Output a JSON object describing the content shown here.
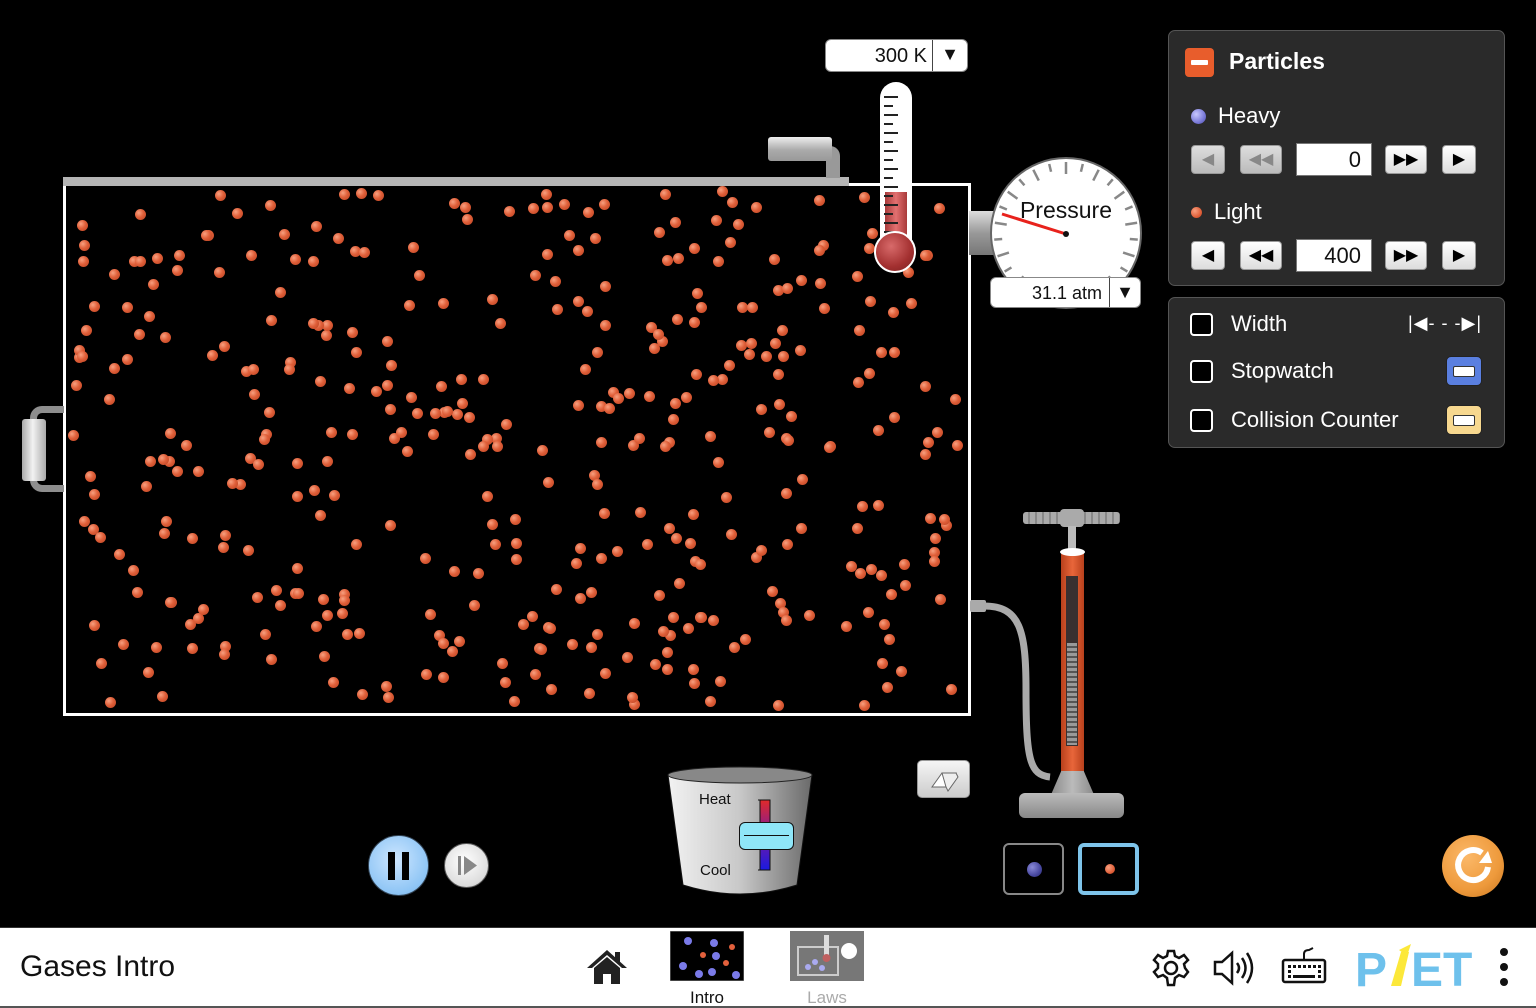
{
  "app": {
    "title": "Gases Intro",
    "screens": [
      {
        "label": "Intro",
        "selected": true
      },
      {
        "label": "Laws",
        "selected": false
      }
    ]
  },
  "thermometer": {
    "value": "300 K",
    "dropdown_icon": "triangle-down"
  },
  "pressure_gauge": {
    "label": "Pressure",
    "value": "31.1 atm",
    "dropdown_icon": "triangle-down"
  },
  "particles_panel": {
    "title": "Particles",
    "collapse_icon": "minus",
    "heavy": {
      "label": "Heavy",
      "count": "0",
      "color": "#8080f0"
    },
    "light": {
      "label": "Light",
      "count": "400",
      "color": "#e2603c"
    }
  },
  "tools_panel": {
    "items": [
      {
        "label": "Width",
        "checked": false,
        "icon": "width-arrows",
        "icon_text": "|◀- - -▶|"
      },
      {
        "label": "Stopwatch",
        "checked": false,
        "icon": "stopwatch",
        "icon_color": "#5a7fe0"
      },
      {
        "label": "Collision Counter",
        "checked": false,
        "icon": "collision-counter",
        "icon_color": "#f7d88f"
      }
    ]
  },
  "heater_cooler": {
    "heat_label": "Heat",
    "cool_label": "Cool"
  },
  "simulation": {
    "light_particle_count": 400,
    "heavy_particle_count": 0,
    "running": true,
    "selected_species": "light"
  },
  "colors": {
    "light_particle": "#e2603c",
    "heavy_particle": "#7a7ad8",
    "selector_highlight": "#7ec4ea",
    "reset": "#ee9a3c",
    "phet_blue": "#6ec1ec",
    "phet_yellow": "#fce83a"
  },
  "navbar": {
    "logo_text": "PhET"
  }
}
